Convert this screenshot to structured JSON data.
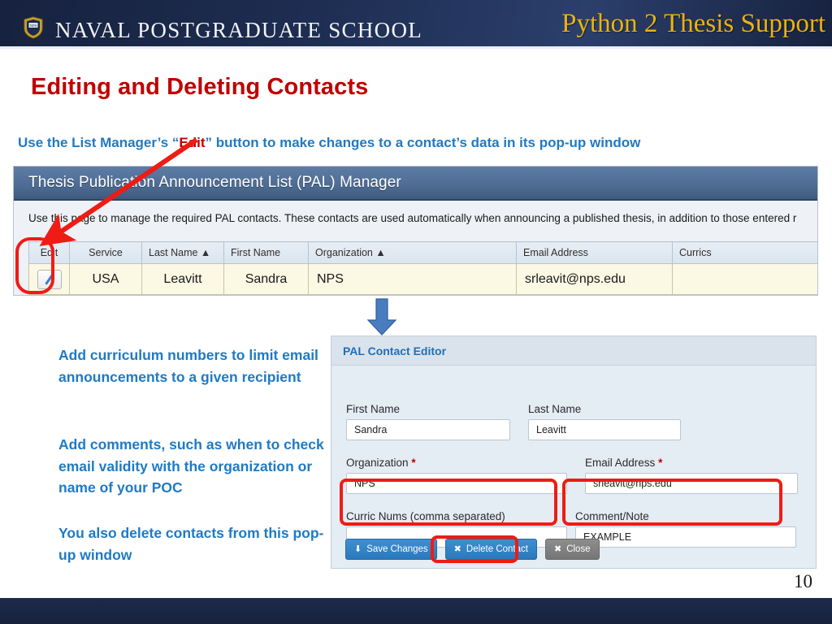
{
  "header": {
    "school_name": "NAVAL POSTGRADUATE SCHOOL",
    "deck_title": "Python 2 Thesis Support",
    "logo_icon": "nps-shield-crest-icon"
  },
  "slide": {
    "title": "Editing and Deleting Contacts",
    "subtitle_pre": "Use the List Manager’s “",
    "subtitle_highlight": "Edit",
    "subtitle_post": "” button to make changes to a contact’s data in its pop-up window",
    "page_number": "10"
  },
  "pal_manager": {
    "bar_title": "Thesis Publication Announcement List (PAL) Manager",
    "description": "Use this page to manage the required PAL contacts. These contacts are used automatically when announcing a published thesis, in addition to those entered r",
    "columns": [
      "Edit",
      "Service",
      "Last Name ▲",
      "First Name",
      "Organization ▲",
      "Email Address",
      "Currics"
    ],
    "row": {
      "edit_icon": "pencil-icon",
      "service": "USA",
      "last_name": "Leavitt",
      "first_name": "Sandra",
      "organization": "NPS",
      "email": "srleavit@nps.edu",
      "currics": ""
    }
  },
  "notes": {
    "note_1": "Add curriculum numbers to limit email announcements to a given recipient",
    "note_2": "Add comments, such as when to check email validity with the organization or name of your POC",
    "note_3": "You also delete contacts from this pop-up window"
  },
  "dialog": {
    "title": "PAL Contact Editor",
    "fields": {
      "first_name_label": "First Name",
      "first_name_value": "Sandra",
      "last_name_label": "Last Name",
      "last_name_value": "Leavitt",
      "organization_label": "Organization",
      "organization_value": "NPS",
      "email_label": "Email Address",
      "email_value": "srleavit@nps.edu",
      "curric_label": "Curric Nums (comma separated)",
      "curric_value": "",
      "comment_label": "Comment/Note",
      "comment_value": "EXAMPLE",
      "required_mark": "*"
    },
    "buttons": {
      "save": "Save Changes",
      "save_icon": "download-icon",
      "delete": "Delete Contact",
      "delete_icon": "x-icon",
      "close": "Close",
      "close_icon": "x-icon"
    }
  },
  "annotations": {
    "red_arrow": "red-arrow-pointing-to-edit-column",
    "blue_arrow": "blue-down-arrow",
    "highlight_color": "#ee1c14"
  }
}
